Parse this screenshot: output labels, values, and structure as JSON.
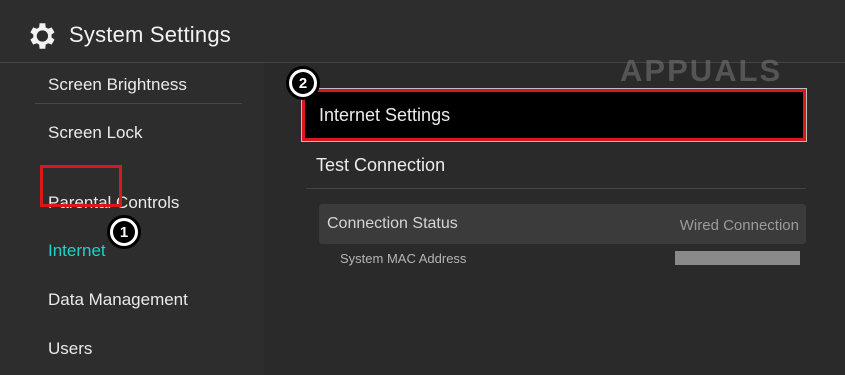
{
  "header": {
    "title": "System Settings",
    "icon": "gear-icon"
  },
  "sidebar": {
    "items": [
      {
        "label": "Screen Brightness"
      },
      {
        "label": "Screen Lock"
      },
      {
        "label": "Parental Controls"
      },
      {
        "label": "Internet"
      },
      {
        "label": "Data Management"
      },
      {
        "label": "Users"
      }
    ],
    "selected": "Internet"
  },
  "main": {
    "menu": [
      {
        "label": "Internet Settings"
      },
      {
        "label": "Test Connection"
      }
    ],
    "status": {
      "label": "Connection Status",
      "value": "Wired Connection"
    },
    "mac": {
      "label": "System MAC Address"
    }
  },
  "annotations": {
    "badge1": "1",
    "badge2": "2"
  },
  "watermark": "APPUALS",
  "colors": {
    "background": "#2d2d2d",
    "selected_text": "#1fd1c6",
    "highlight_border": "#d8181c",
    "selected_row": "#000000"
  }
}
